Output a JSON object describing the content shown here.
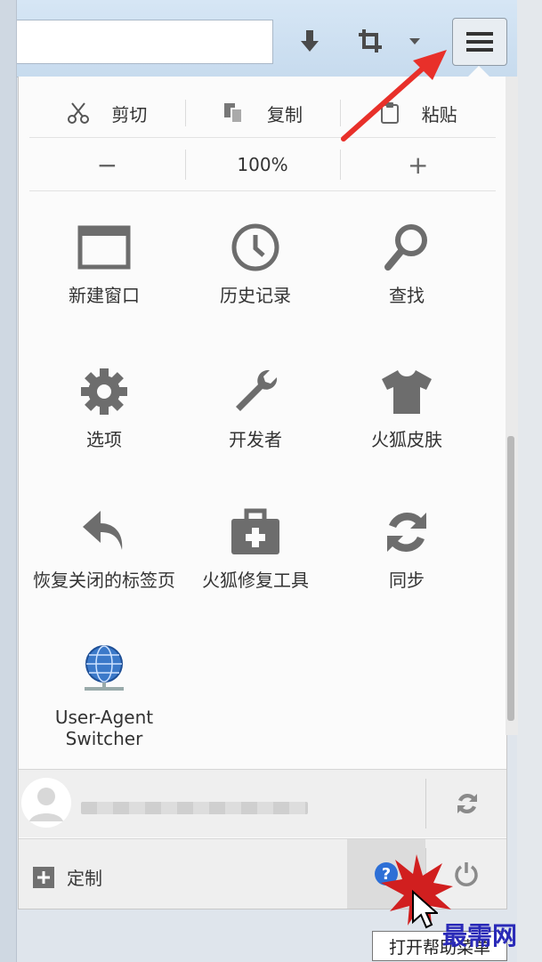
{
  "edit": {
    "cut": "剪切",
    "copy": "复制",
    "paste": "粘贴"
  },
  "zoom": {
    "out": "−",
    "level": "100%",
    "in": "+"
  },
  "tiles": [
    {
      "label": "新建窗口",
      "icon": "new-window-icon"
    },
    {
      "label": "历史记录",
      "icon": "history-clock-icon"
    },
    {
      "label": "查找",
      "icon": "search-icon"
    },
    {
      "label": "选项",
      "icon": "gear-icon"
    },
    {
      "label": "开发者",
      "icon": "wrench-icon"
    },
    {
      "label": "火狐皮肤",
      "icon": "tshirt-icon"
    },
    {
      "label": "恢复关闭的标签页",
      "icon": "undo-arrow-icon"
    },
    {
      "label": "火狐修复工具",
      "icon": "toolbox-icon"
    },
    {
      "label": "同步",
      "icon": "sync-icon"
    },
    {
      "label": "User-Agent Switcher",
      "icon": "globe-icon"
    }
  ],
  "footer": {
    "customize": "定制"
  },
  "tooltip": "打开帮助菜单",
  "watermark": "最需网",
  "colors": {
    "arrow": "#e8302a",
    "help_blue": "#2d6fd6",
    "icon_gray": "#6d6d6d"
  }
}
